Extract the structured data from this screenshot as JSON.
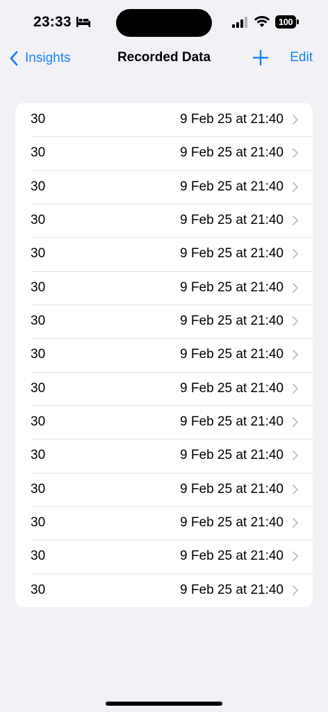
{
  "status_bar": {
    "time": "23:33",
    "battery": "100",
    "icons": [
      "bed-icon",
      "cellular-signal-icon",
      "wifi-icon",
      "battery-icon"
    ]
  },
  "nav": {
    "back_label": "Insights",
    "title": "Recorded Data",
    "add_icon": "plus-icon",
    "edit_label": "Edit"
  },
  "records": [
    {
      "value": "30",
      "date": "9 Feb 25 at 21:40"
    },
    {
      "value": "30",
      "date": "9 Feb 25 at 21:40"
    },
    {
      "value": "30",
      "date": "9 Feb 25 at 21:40"
    },
    {
      "value": "30",
      "date": "9 Feb 25 at 21:40"
    },
    {
      "value": "30",
      "date": "9 Feb 25 at 21:40"
    },
    {
      "value": "30",
      "date": "9 Feb 25 at 21:40"
    },
    {
      "value": "30",
      "date": "9 Feb 25 at 21:40"
    },
    {
      "value": "30",
      "date": "9 Feb 25 at 21:40"
    },
    {
      "value": "30",
      "date": "9 Feb 25 at 21:40"
    },
    {
      "value": "30",
      "date": "9 Feb 25 at 21:40"
    },
    {
      "value": "30",
      "date": "9 Feb 25 at 21:40"
    },
    {
      "value": "30",
      "date": "9 Feb 25 at 21:40"
    },
    {
      "value": "30",
      "date": "9 Feb 25 at 21:40"
    },
    {
      "value": "30",
      "date": "9 Feb 25 at 21:40"
    },
    {
      "value": "30",
      "date": "9 Feb 25 at 21:40"
    }
  ],
  "colors": {
    "accent": "#1a82f7",
    "background": "#f2f1f6",
    "card": "#ffffff",
    "chevron": "#c4c4c8"
  }
}
